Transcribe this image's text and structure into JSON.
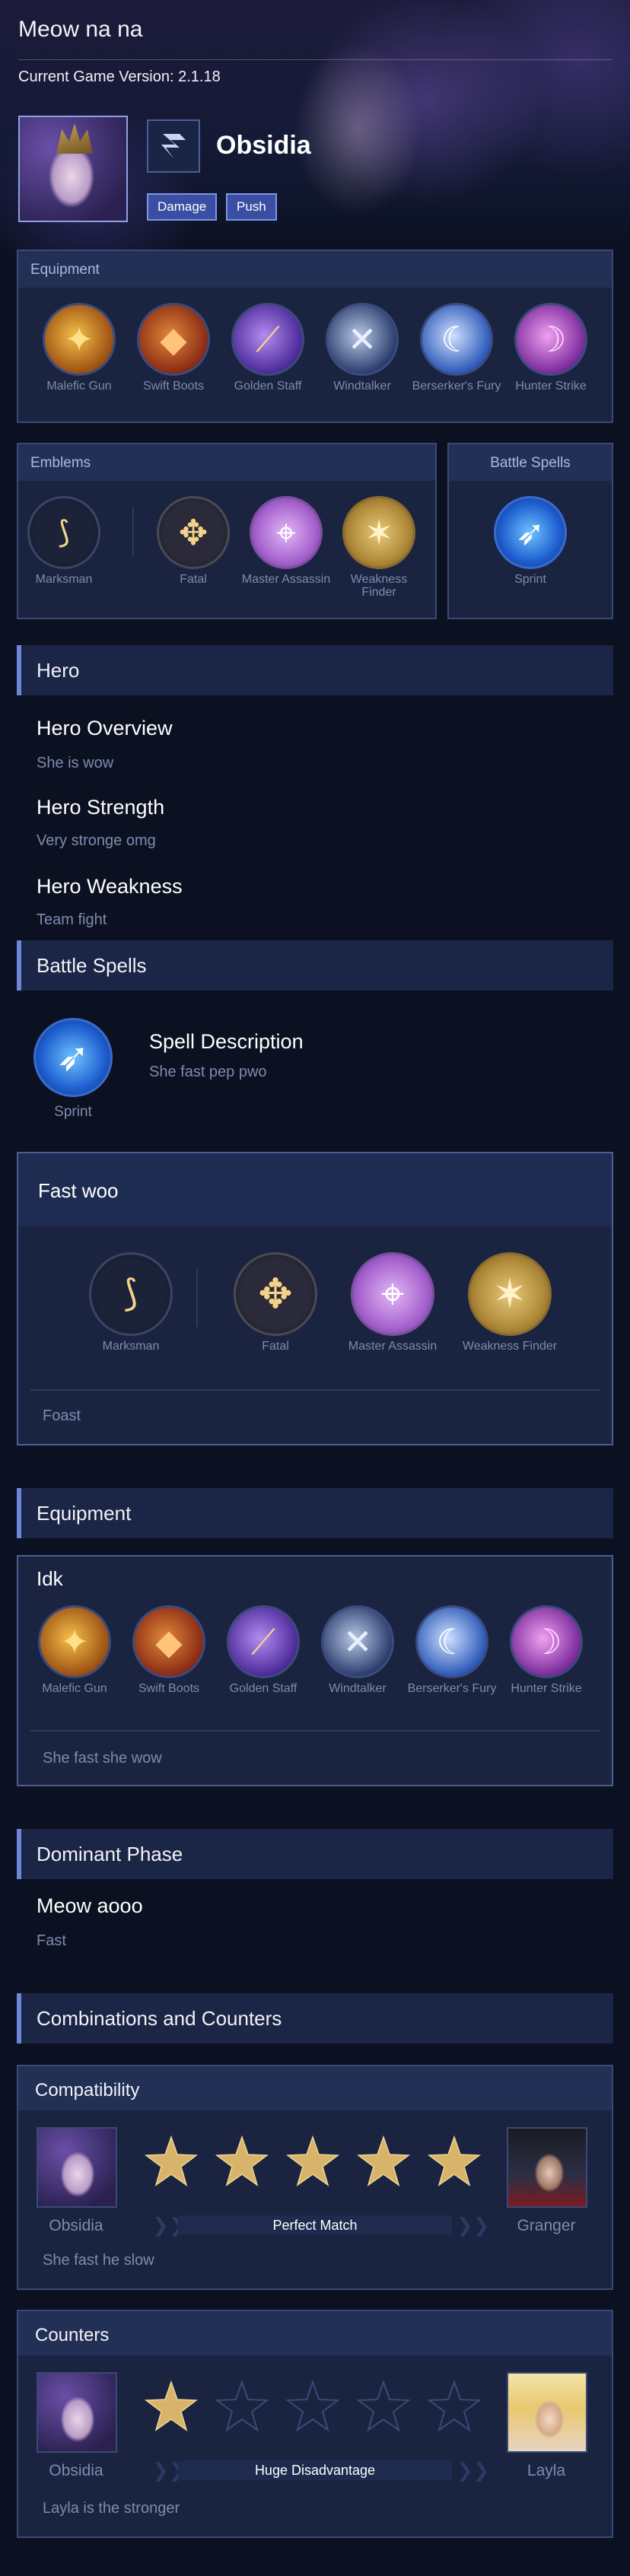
{
  "app": {
    "title": "Meow na na",
    "version_label": "Current Game Version: 2.1.18"
  },
  "hero": {
    "name": "Obsidia",
    "class_icon": "marksman-emblem-icon",
    "roles": [
      "Damage",
      "Push"
    ]
  },
  "equipment_panel": {
    "title": "Equipment",
    "items": [
      {
        "label": "Malefic Gun",
        "icon": "malefic-gun-icon"
      },
      {
        "label": "Swift Boots",
        "icon": "swift-boots-icon"
      },
      {
        "label": "Golden Staff",
        "icon": "golden-staff-icon"
      },
      {
        "label": "Windtalker",
        "icon": "windtalker-icon"
      },
      {
        "label": "Berserker's Fury",
        "icon": "berserkers-fury-icon"
      },
      {
        "label": "Hunter Strike",
        "icon": "hunter-strike-icon"
      }
    ]
  },
  "emblems_panel": {
    "title": "Emblems",
    "items": [
      {
        "label": "Marksman",
        "icon": "marksman-bow-icon"
      },
      {
        "label": "Fatal",
        "icon": "fatal-icon"
      },
      {
        "label": "Master Assassin",
        "icon": "master-assassin-icon"
      },
      {
        "label": "Weakness Finder",
        "icon": "weakness-finder-icon"
      }
    ]
  },
  "spells_panel": {
    "title": "Battle Spells",
    "spell": {
      "label": "Sprint",
      "icon": "sprint-icon"
    }
  },
  "hero_section": {
    "title": "Hero",
    "overview_title": "Hero Overview",
    "overview_text": "She is wow",
    "strength_title": "Hero Strength",
    "strength_text": "Very stronge omg",
    "weakness_title": "Hero Weakness",
    "weakness_text": "Team fight"
  },
  "battle_spells_section": {
    "title": "Battle Spells",
    "spell_label": "Sprint",
    "desc_title": "Spell Description",
    "desc_text": "She fast pep pwo"
  },
  "emblem_build": {
    "title": "Fast woo",
    "items": [
      {
        "label": "Marksman"
      },
      {
        "label": "Fatal"
      },
      {
        "label": "Master Assassin"
      },
      {
        "label": "Weakness Finder"
      }
    ],
    "note": "Foast"
  },
  "equipment_section": {
    "title": "Equipment",
    "build_title": "Idk",
    "items": [
      {
        "label": "Malefic Gun"
      },
      {
        "label": "Swift Boots"
      },
      {
        "label": "Golden Staff"
      },
      {
        "label": "Windtalker"
      },
      {
        "label": "Berserker's Fury"
      },
      {
        "label": "Hunter Strike"
      }
    ],
    "note": "She fast she wow"
  },
  "dominant_phase": {
    "title": "Dominant Phase",
    "heading": "Meow aooo",
    "text": "Fast"
  },
  "combos": {
    "title": "Combinations and Counters",
    "compatibility": {
      "title": "Compatibility",
      "left_hero": "Obsidia",
      "right_hero": "Granger",
      "stars_filled": 5,
      "stars_total": 5,
      "rating_label": "Perfect Match",
      "note": "She fast he slow"
    },
    "counters": {
      "title": "Counters",
      "left_hero": "Obsidia",
      "right_hero": "Layla",
      "stars_filled": 1,
      "stars_total": 5,
      "rating_label": "Huge Disadvantage",
      "note": "Layla is the stronger"
    }
  }
}
